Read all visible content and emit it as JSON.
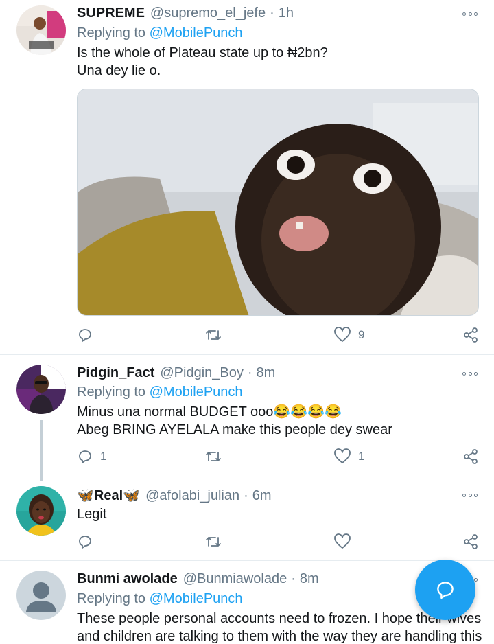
{
  "tweets": [
    {
      "name": "SUPREME",
      "handle": "@supremo_el_jefe",
      "dot": "·",
      "time": "1h",
      "replying_prefix": "Replying to",
      "replying_to": "@MobilePunch",
      "text_lines": [
        "Is the whole of Plateau state up to ₦2bn?",
        "Una dey lie o."
      ],
      "reply_count": "",
      "retweet_count": "",
      "like_count": "9"
    },
    {
      "name": "Pidgin_Fact",
      "handle": "@Pidgin_Boy",
      "dot": "·",
      "time": "8m",
      "replying_prefix": "Replying to",
      "replying_to": "@MobilePunch",
      "text_lines": [
        "Minus una normal BUDGET ooo😂😂😂😂",
        "Abeg BRING AYELALA make this people dey swear"
      ],
      "reply_count": "1",
      "retweet_count": "",
      "like_count": "1"
    },
    {
      "name_prefix": "🦋",
      "name": "Real",
      "name_suffix": "🦋",
      "handle": "@afolabi_julian",
      "dot": "·",
      "time": "6m",
      "text_lines": [
        "Legit"
      ],
      "reply_count": "",
      "retweet_count": "",
      "like_count": ""
    },
    {
      "name": "Bunmi awolade",
      "handle": "@Bunmiawolade",
      "dot": "·",
      "time": "8m",
      "replying_prefix": "Replying to",
      "replying_to": "@MobilePunch",
      "text_lines": [
        "These people personal accounts need to frozen. I hope their wives",
        "and children are talking to them with the way they are handling this"
      ]
    }
  ],
  "icons": {
    "reply": "reply-icon",
    "retweet": "retweet-icon",
    "like": "heart-icon",
    "share": "share-icon",
    "more": "more-options-icon",
    "compose": "compose-reply-icon"
  },
  "colors": {
    "accent": "#1da1f2",
    "secondary_text": "#657786",
    "divider": "#e6ecf0"
  }
}
